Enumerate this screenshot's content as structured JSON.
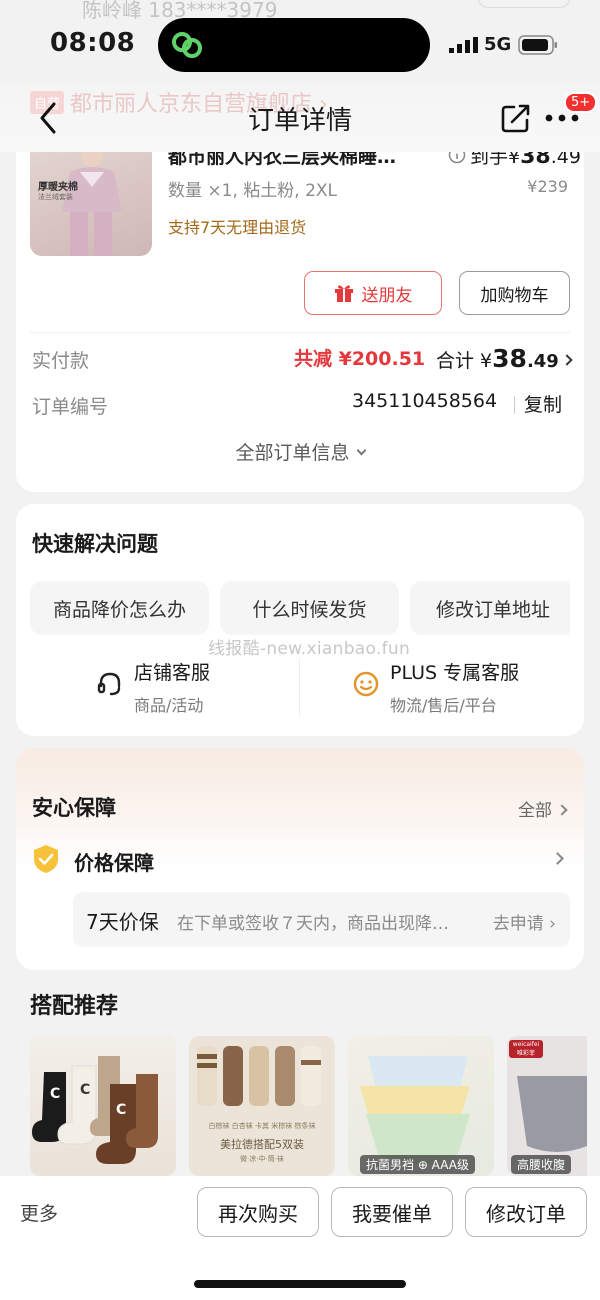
{
  "status": {
    "time": "08:08",
    "network": "5G",
    "ghost_name": "陈岭峰 183****3979"
  },
  "nav": {
    "title": "订单详情",
    "badge": "5+",
    "ghost_store_tag": "自营",
    "ghost_store": "都市丽人京东自营旗舰店 ›"
  },
  "order": {
    "product": {
      "title": "都市丽人内衣三层夹棉睡…",
      "img_label1": "厚暖夹棉",
      "img_label2": "法兰绒套装",
      "price_prefix": "到手",
      "price_symbol": "¥",
      "price_int": "38",
      "price_dec": ".49",
      "spec": "数量 ×1, 粘土粉, 2XL",
      "original_price": "¥239",
      "return_policy": "支持7天无理由退货"
    },
    "gift_label": "送朋友",
    "cart_label": "加购物车",
    "paid_label": "实付款",
    "reduce": "共减 ¥200.51",
    "total_prefix": "合计 ¥",
    "total_int": "38",
    "total_dec": ".49",
    "order_no_label": "订单编号",
    "order_no": "345110458564",
    "copy_label": "复制",
    "all_info": "全部订单信息"
  },
  "quick": {
    "title": "快速解决问题",
    "chips": [
      "商品降价怎么办",
      "什么时候发货",
      "修改订单地址"
    ],
    "watermark": "线报酷-new.xianbao.fun",
    "services": [
      {
        "name": "店铺客服",
        "sub": "商品/活动"
      },
      {
        "name": "PLUS 专属客服",
        "sub": "物流/售后/平台"
      }
    ]
  },
  "guarantee": {
    "title": "安心保障",
    "all_label": "全部",
    "price_guarantee": "价格保障",
    "protect_title": "7天价保",
    "protect_desc": "在下单或签收７天内，商品出现降…",
    "apply_label": "去申请 ›"
  },
  "recommend": {
    "title": "搭配推荐",
    "item2_caption": "美拉德搭配5双装",
    "item2_sub": "白棕袜 白杏袜 卡其 米棕袜 棕条袜",
    "item2_sub2": "微·凉·中·筒·袜",
    "item3_badge": "抗菌男裆 ⊕ AAA级",
    "item4_brand": "weicaifei 唯彩菲",
    "item4_badge": "高腰收腹"
  },
  "bottom": {
    "more": "更多",
    "buttons": [
      "再次购买",
      "我要催单",
      "修改订单"
    ]
  },
  "colors": {
    "accent_red": "#e4393c",
    "return_gold": "#a36a1a",
    "plus_orange": "#e4942a"
  }
}
